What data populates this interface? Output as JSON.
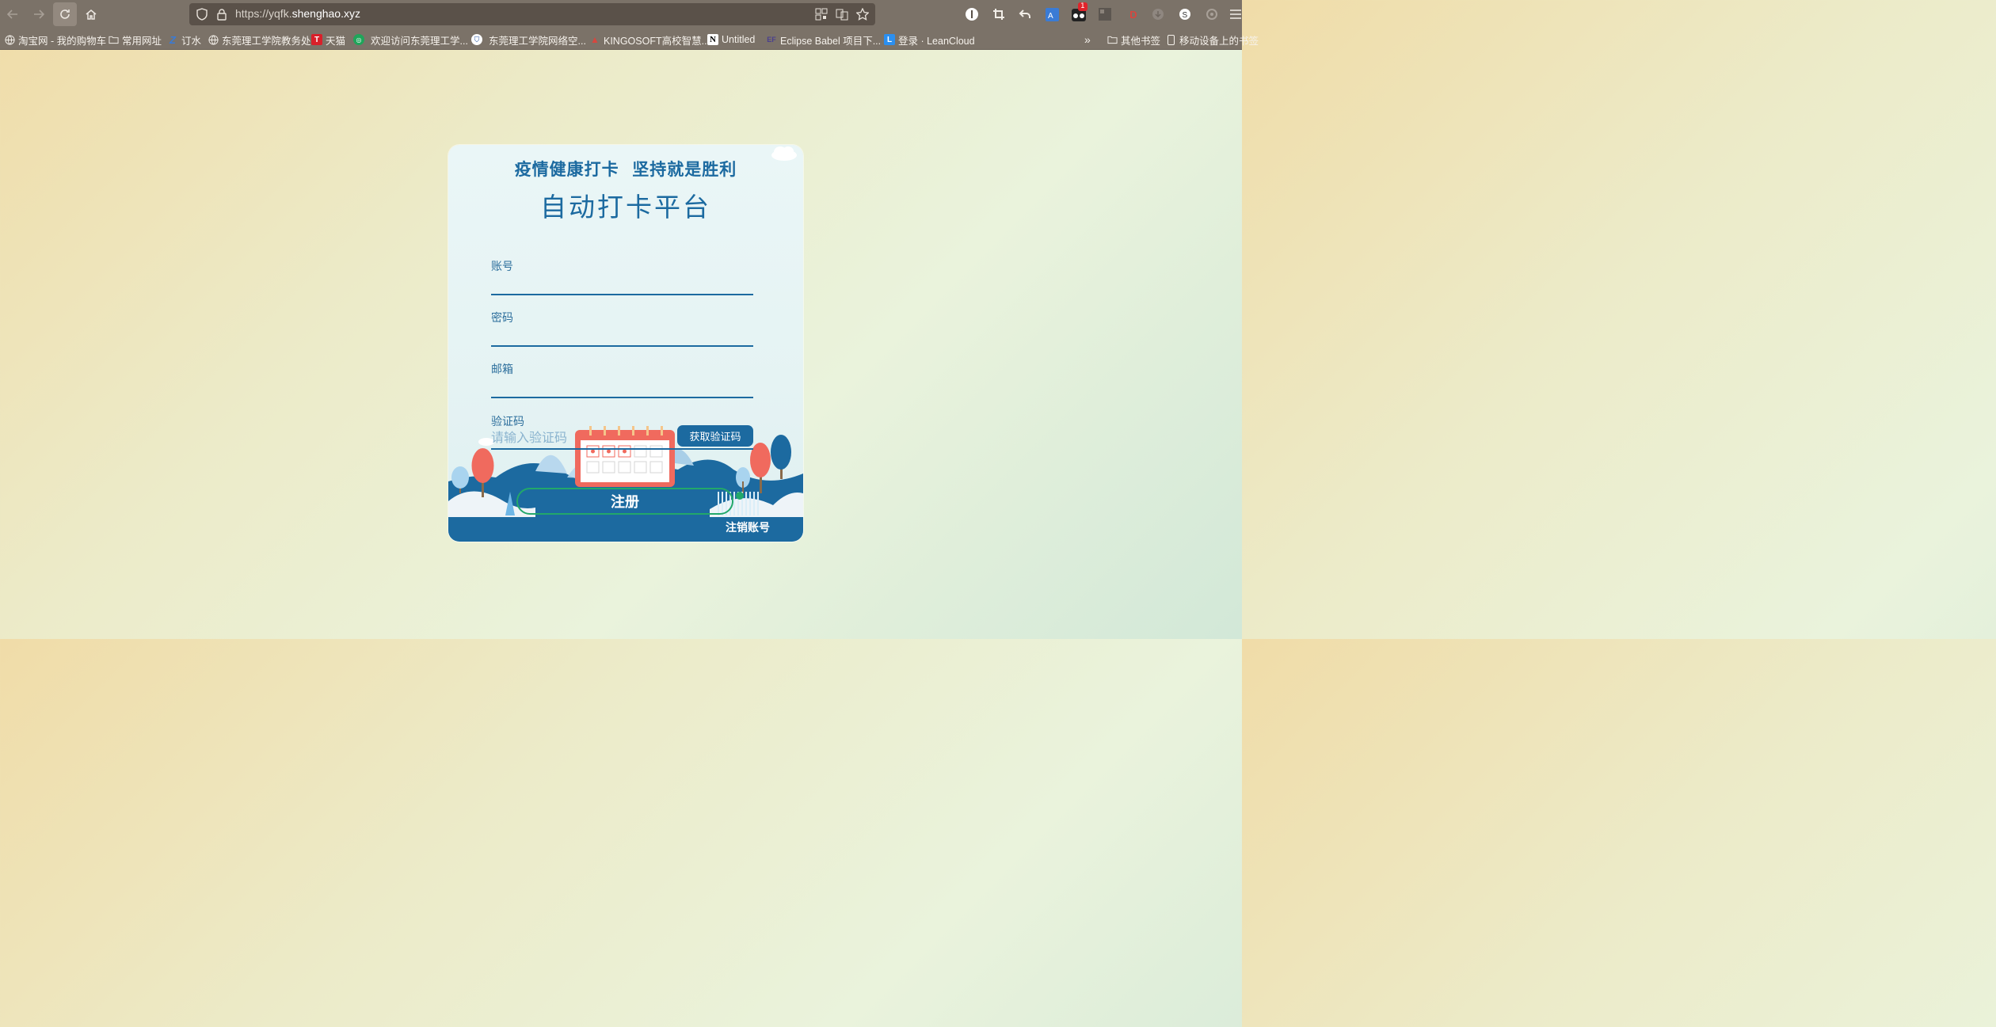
{
  "browser": {
    "url_prefix": "https://yqfk.",
    "url_domain": "shenghao.xyz",
    "extension_badge": "1",
    "bookmarks": [
      {
        "label": "淘宝网 - 我的购物车",
        "icon": "globe-icon"
      },
      {
        "label": "常用网址",
        "icon": "folder-icon"
      },
      {
        "label": "订水",
        "icon": "z-icon"
      },
      {
        "label": "东莞理工学院教务处",
        "icon": "globe-icon"
      },
      {
        "label": "天猫",
        "icon": "tmall-icon"
      },
      {
        "label": "欢迎访问东莞理工学...",
        "icon": "green-circle-icon"
      },
      {
        "label": "东莞理工学院网络空...",
        "icon": "shield-icon"
      },
      {
        "label": "KINGOSOFT高校智慧...",
        "icon": "kingosoft-icon"
      },
      {
        "label": "Untitled",
        "icon": "notion-icon"
      },
      {
        "label": "Eclipse Babel 项目下...",
        "icon": "eclipse-icon"
      },
      {
        "label": "登录 · LeanCloud",
        "icon": "leancloud-icon"
      }
    ],
    "other_bookmarks": "其他书签",
    "mobile_bookmarks": "移动设备上的书签"
  },
  "page": {
    "slogan": "疫情健康打卡  坚持就是胜利",
    "title": "自动打卡平台",
    "account_label": "账号",
    "account_value": "",
    "password_label": "密码",
    "password_value": "",
    "email_label": "邮箱",
    "email_value": "",
    "code_label": "验证码",
    "code_placeholder": "请输入验证码",
    "get_code_button": "获取验证码",
    "register_button": "注册",
    "cancel_account_link": "注销账号"
  },
  "colors": {
    "primary": "#1c6aa0",
    "accent_green": "#22a86a",
    "coral": "#f06a5e"
  }
}
